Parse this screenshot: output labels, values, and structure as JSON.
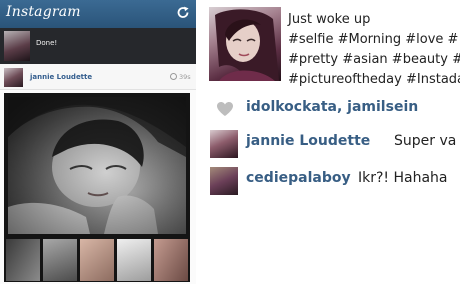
{
  "app": {
    "title": "Instagram"
  },
  "notification": {
    "text": "Done!"
  },
  "post": {
    "username": "jannie Loudette",
    "time_ago": "39s"
  },
  "caption": {
    "lines": [
      "Just woke up",
      "#selfie #Morning #love #",
      "#pretty #asian #beauty #i",
      "#pictureoftheday #Instada"
    ]
  },
  "likes": {
    "text": "idolkockata, jamilsein"
  },
  "comments": [
    {
      "user": "jannie Loudette",
      "text": "Super va"
    },
    {
      "user": "cediepalaboy",
      "text": "Ikr?! Hahaha"
    }
  ],
  "colors": {
    "header_bar": "#2f5b82",
    "username_blue": "#385e84",
    "notification_bg": "#26282c"
  },
  "icons": {
    "refresh": "refresh-icon",
    "heart": "heart-icon",
    "clock": "clock-icon"
  }
}
